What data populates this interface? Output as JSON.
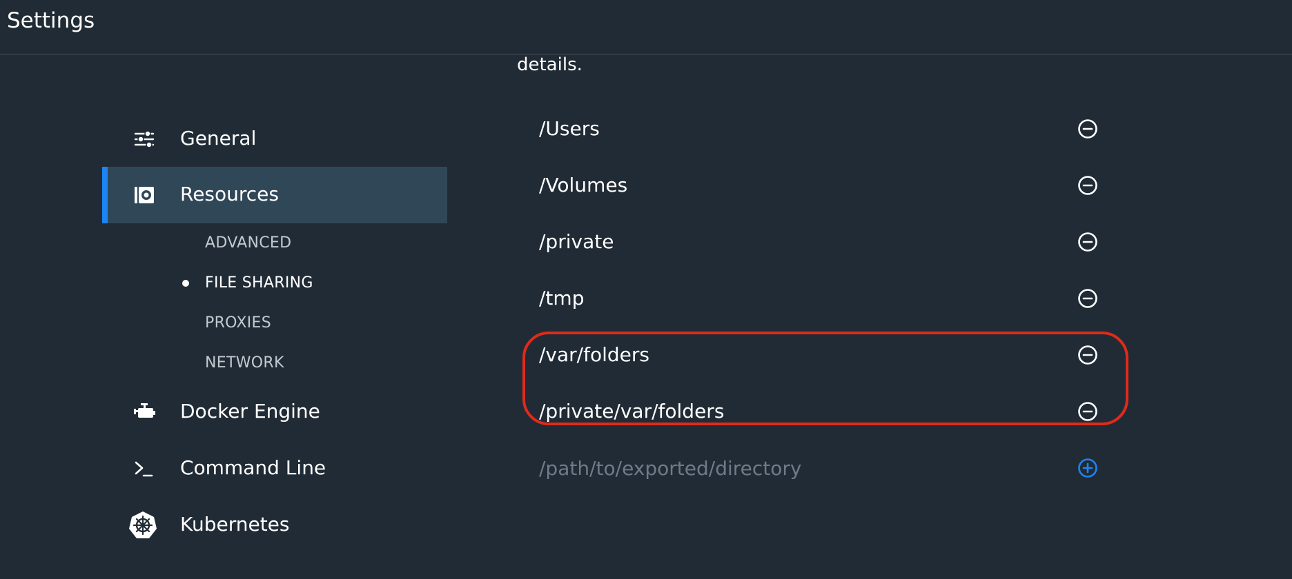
{
  "header": {
    "title": "Settings"
  },
  "sidebar": {
    "items": [
      {
        "label": "General",
        "icon": "sliders-icon"
      },
      {
        "label": "Resources",
        "icon": "resources-icon",
        "active": true
      },
      {
        "label": "Docker Engine",
        "icon": "engine-icon"
      },
      {
        "label": "Command Line",
        "icon": "terminal-icon"
      },
      {
        "label": "Kubernetes",
        "icon": "kubernetes-icon"
      }
    ],
    "resources_subitems": [
      {
        "label": "ADVANCED"
      },
      {
        "label": "FILE SHARING",
        "current": true
      },
      {
        "label": "PROXIES"
      },
      {
        "label": "NETWORK"
      }
    ]
  },
  "main": {
    "description_tail": "details.",
    "paths": [
      {
        "path": "/Users"
      },
      {
        "path": "/Volumes"
      },
      {
        "path": "/private"
      },
      {
        "path": "/tmp"
      },
      {
        "path": "/var/folders"
      },
      {
        "path": "/private/var/folders"
      }
    ],
    "new_path": {
      "value": "",
      "placeholder": "/path/to/exported/directory"
    }
  },
  "colors": {
    "background": "#212b35",
    "active_item_bg": "#304758",
    "accent": "#1d84f3",
    "highlight": "#e02a1a",
    "placeholder": "#6f7b86"
  }
}
